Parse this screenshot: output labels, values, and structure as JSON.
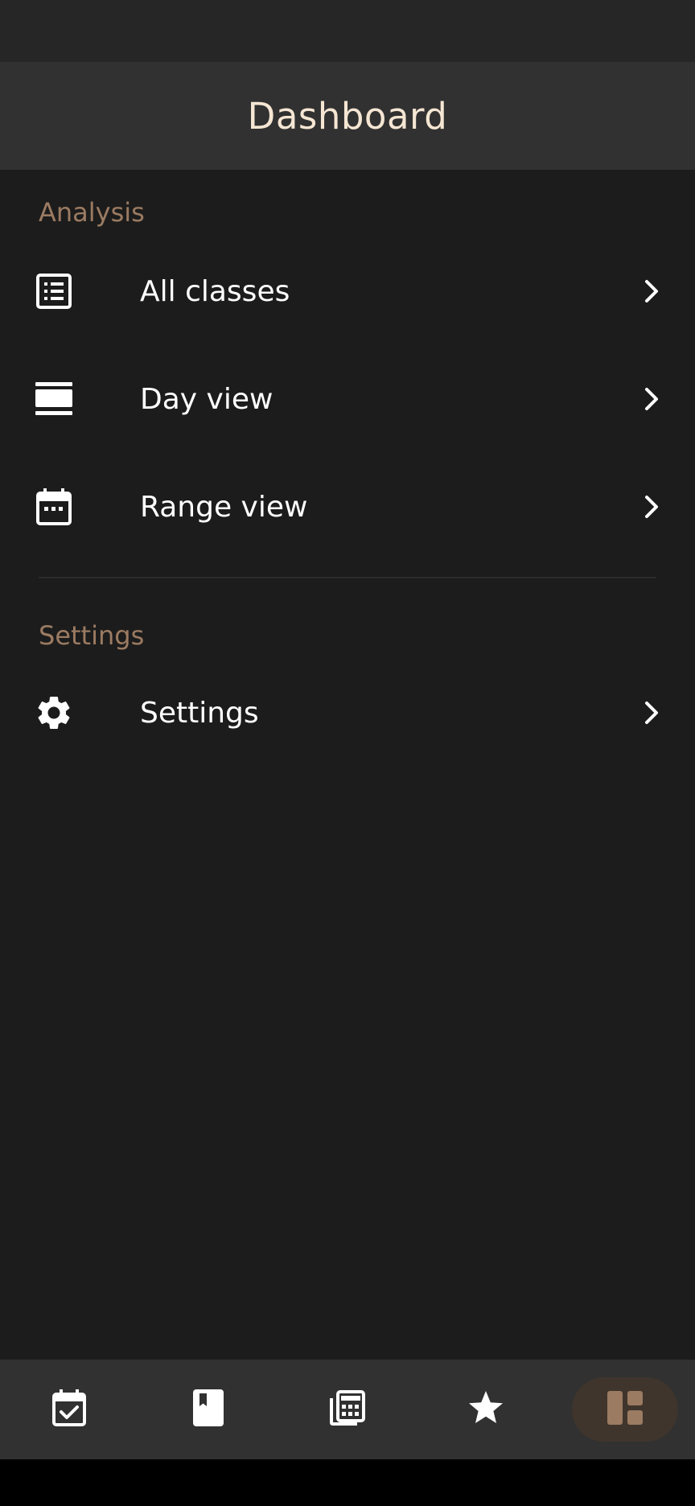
{
  "app_bar": {
    "title": "Dashboard"
  },
  "sections": [
    {
      "header": "Analysis",
      "items": [
        {
          "label": "All classes",
          "icon": "list-icon"
        },
        {
          "label": "Day view",
          "icon": "day-view-icon"
        },
        {
          "label": "Range view",
          "icon": "calendar-icon"
        }
      ]
    },
    {
      "header": "Settings",
      "items": [
        {
          "label": "Settings",
          "icon": "gear-icon"
        }
      ]
    }
  ],
  "bottom_nav": {
    "items": [
      {
        "icon": "calendar-check-icon",
        "active": false
      },
      {
        "icon": "book-icon",
        "active": false
      },
      {
        "icon": "calculator-icon",
        "active": false
      },
      {
        "icon": "star-icon",
        "active": false
      },
      {
        "icon": "dashboard-icon",
        "active": true
      }
    ]
  },
  "colors": {
    "accent": "#9b7b62",
    "title": "#f5e6d3",
    "background": "#1c1c1c",
    "bar": "#313131",
    "active_pill": "#3f352c"
  }
}
